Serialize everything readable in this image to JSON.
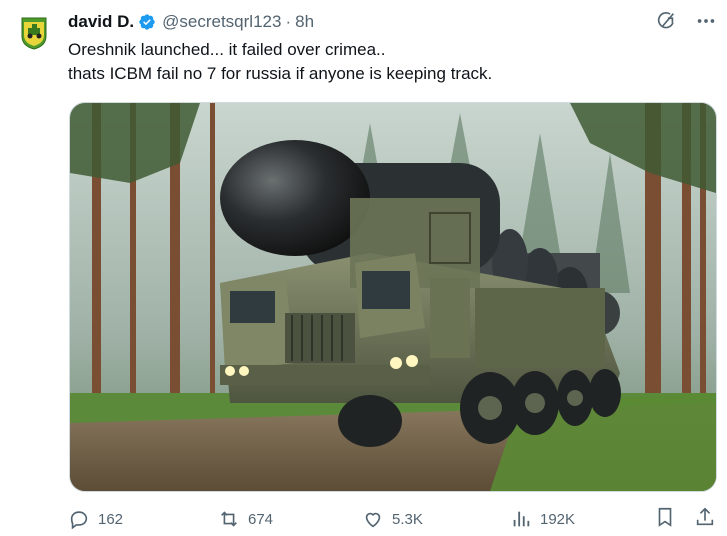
{
  "author": {
    "name": "david D.",
    "handle": "@secretsqrl123",
    "separator": "·",
    "time": "8h"
  },
  "tweet": {
    "line1": "Oreshnik launched... it failed over crimea..",
    "line2": "thats ICBM fail no 7 for russia if anyone is keeping track."
  },
  "media": {
    "icon": "photo"
  },
  "actions": {
    "replies": "162",
    "reposts": "674",
    "likes": "5.3K",
    "views": "192K"
  },
  "icons": {
    "top": [
      "grok-icon",
      "more-icon"
    ],
    "actions": [
      "reply-icon",
      "repost-icon",
      "like-icon",
      "views-icon",
      "bookmark-icon",
      "share-icon"
    ]
  },
  "colors": {
    "text": "#0f1419",
    "secondary": "#536471",
    "verified": "#1d9bf0"
  }
}
